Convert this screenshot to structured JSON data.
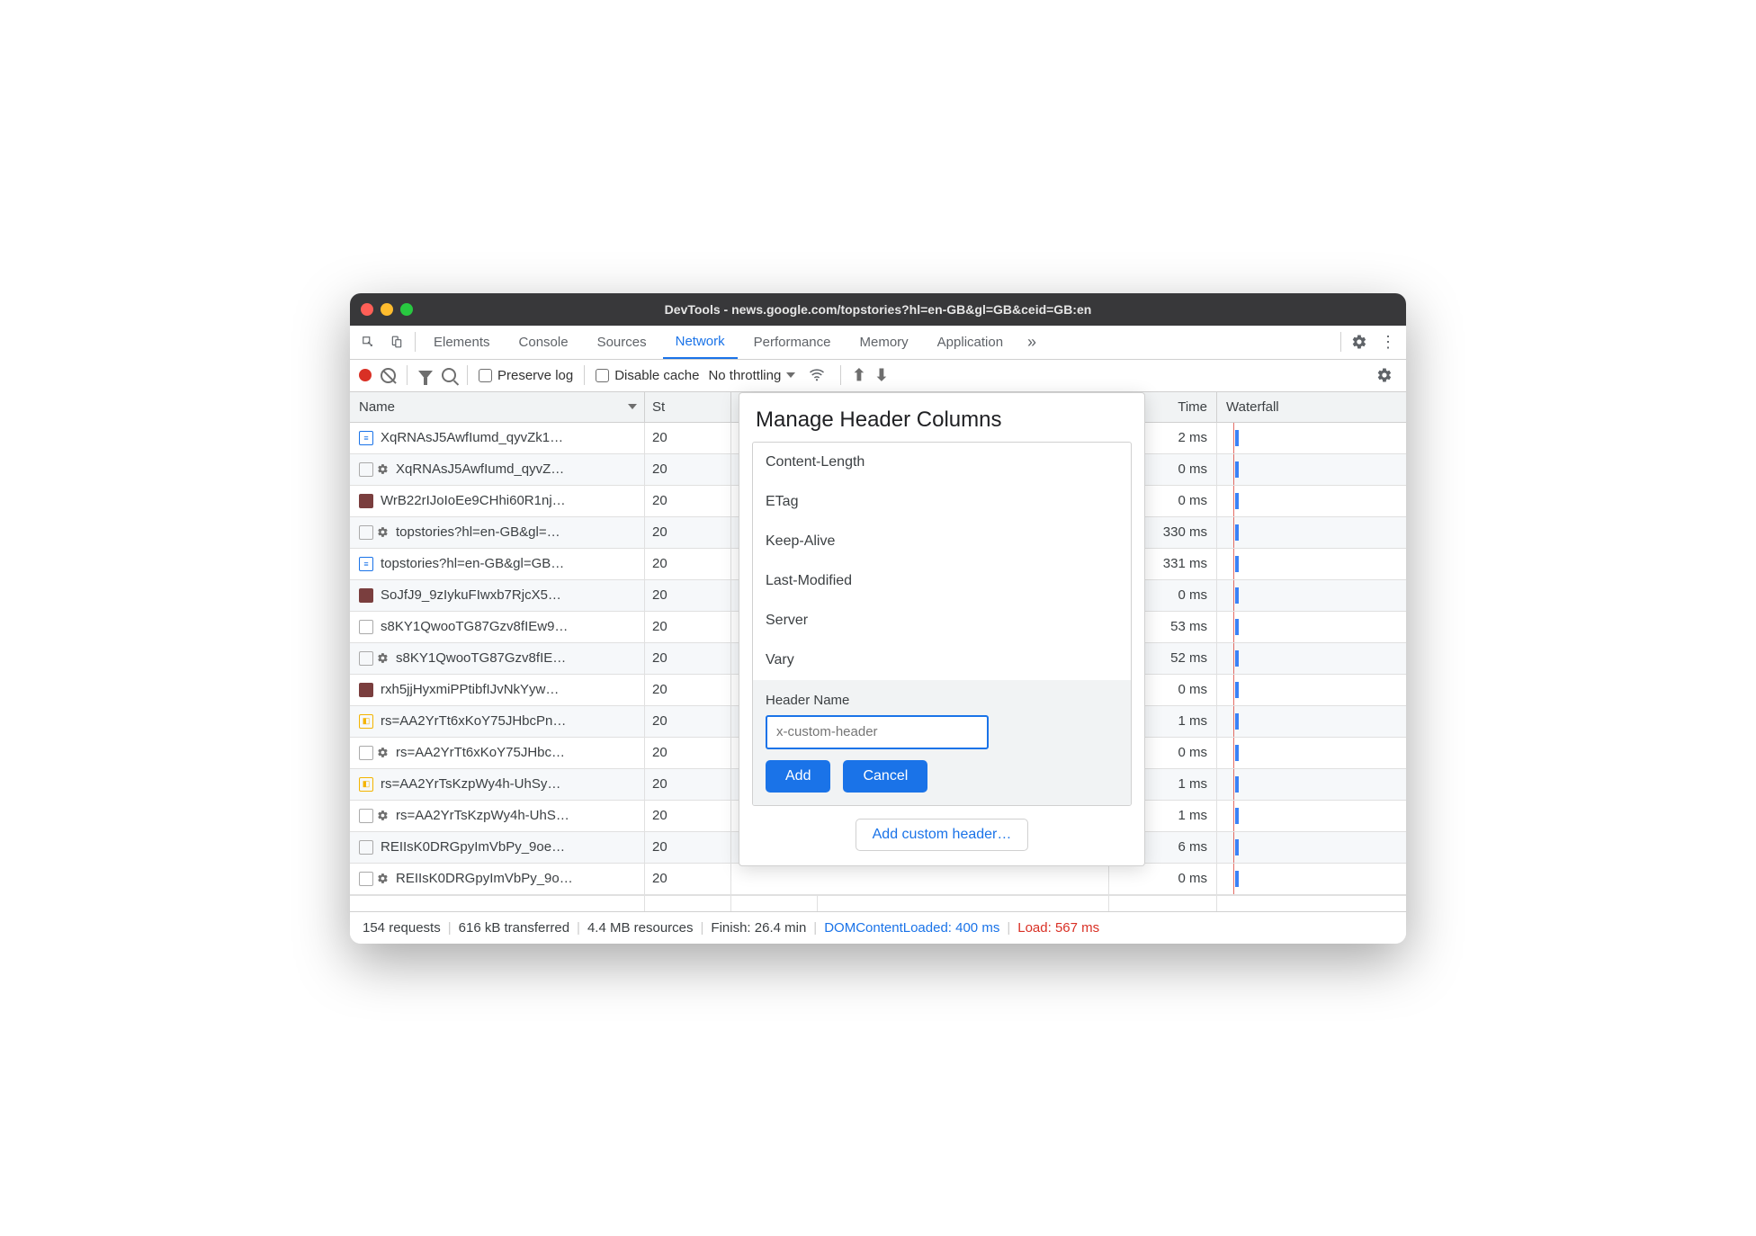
{
  "window": {
    "title": "DevTools - news.google.com/topstories?hl=en-GB&gl=GB&ceid=GB:en"
  },
  "tabs": {
    "items": [
      "Elements",
      "Console",
      "Sources",
      "Network",
      "Performance",
      "Memory",
      "Application"
    ],
    "active": 3
  },
  "toolbar": {
    "preserve_log": "Preserve log",
    "disable_cache": "Disable cache",
    "throttling": "No throttling"
  },
  "headers": {
    "name": "Name",
    "status": "St",
    "time": "Time",
    "waterfall": "Waterfall"
  },
  "rows": [
    {
      "icon": "doc",
      "name": "XqRNAsJ5AwfIumd_qyvZk1…",
      "status": "20",
      "time": "2 ms"
    },
    {
      "icon": "gear",
      "name": "XqRNAsJ5AwfIumd_qyvZ…",
      "status": "20",
      "time": "0 ms"
    },
    {
      "icon": "img",
      "name": "WrB22rIJoIoEe9CHhi60R1nj…",
      "status": "20",
      "time": "0 ms"
    },
    {
      "icon": "gear",
      "name": "topstories?hl=en-GB&gl=…",
      "status": "20",
      "time": "330 ms"
    },
    {
      "icon": "doc",
      "name": "topstories?hl=en-GB&gl=GB…",
      "status": "20",
      "time": "331 ms"
    },
    {
      "icon": "img",
      "name": "SoJfJ9_9zIykuFIwxb7RjcX5…",
      "status": "20",
      "time": "0 ms"
    },
    {
      "icon": "box",
      "name": "s8KY1QwooTG87Gzv8fIEw9…",
      "status": "20",
      "time": "53 ms"
    },
    {
      "icon": "gear",
      "name": "s8KY1QwooTG87Gzv8fIE…",
      "status": "20",
      "time": "52 ms"
    },
    {
      "icon": "img",
      "name": "rxh5jjHyxmiPPtibfIJvNkYyw…",
      "status": "20",
      "time": "0 ms"
    },
    {
      "icon": "js",
      "name": "rs=AA2YrTt6xKoY75JHbcPn…",
      "status": "20",
      "time": "1 ms"
    },
    {
      "icon": "gear",
      "name": "rs=AA2YrTt6xKoY75JHbc…",
      "status": "20",
      "time": "0 ms"
    },
    {
      "icon": "js",
      "name": "rs=AA2YrTsKzpWy4h-UhSy…",
      "status": "20",
      "time": "1 ms"
    },
    {
      "icon": "gear",
      "name": "rs=AA2YrTsKzpWy4h-UhS…",
      "status": "20",
      "time": "1 ms"
    },
    {
      "icon": "box",
      "name": "REIIsK0DRGpyImVbPy_9oe…",
      "status": "20",
      "time": "6 ms"
    },
    {
      "icon": "gear",
      "name": "REIIsK0DRGpyImVbPy_9o…",
      "status": "20",
      "time": "0 ms"
    }
  ],
  "statusbar": {
    "requests": "154 requests",
    "transferred": "616 kB transferred",
    "resources": "4.4 MB resources",
    "finish": "Finish: 26.4 min",
    "dcl": "DOMContentLoaded: 400 ms",
    "load": "Load: 567 ms"
  },
  "modal": {
    "title": "Manage Header Columns",
    "items": [
      "Content-Length",
      "ETag",
      "Keep-Alive",
      "Last-Modified",
      "Server",
      "Vary"
    ],
    "header_name_label": "Header Name",
    "placeholder": "x-custom-header",
    "add": "Add",
    "cancel": "Cancel",
    "add_custom": "Add custom header…"
  }
}
